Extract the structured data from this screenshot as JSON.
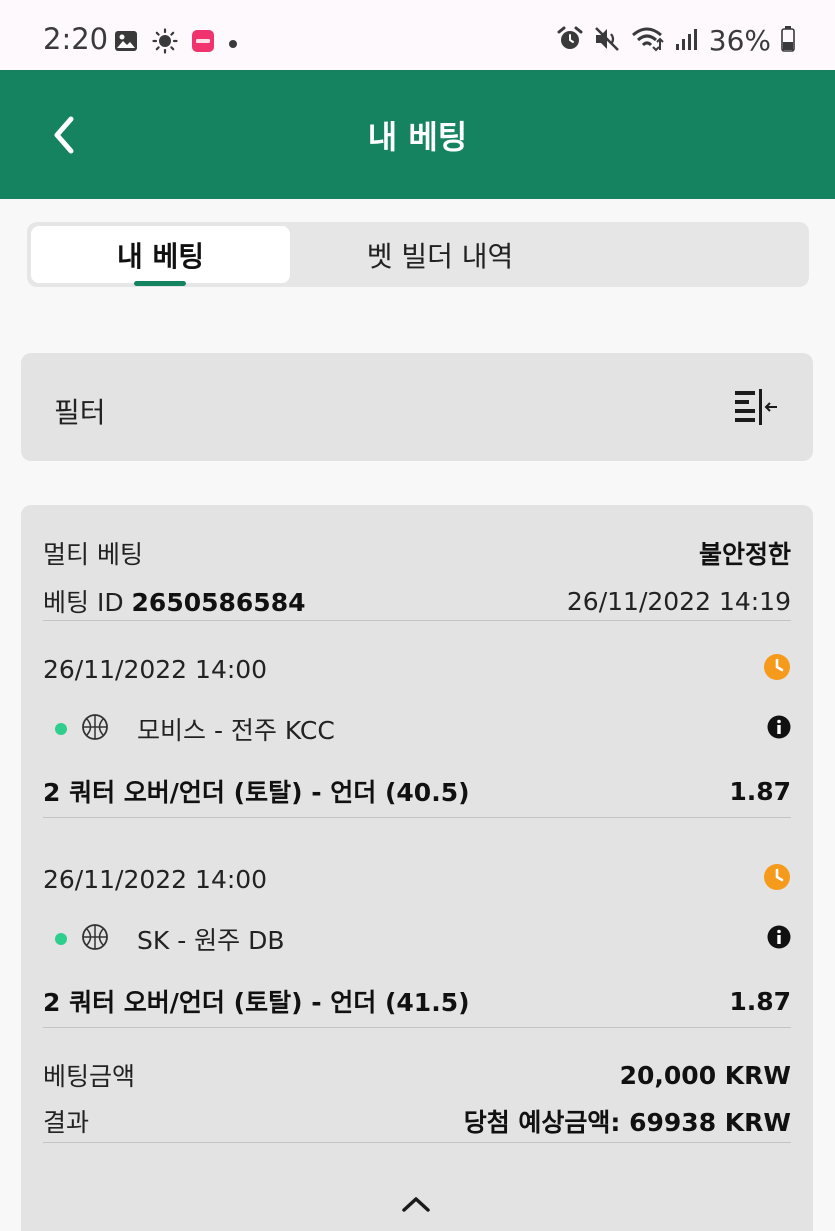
{
  "status_bar": {
    "time": "2:20",
    "battery": "36%",
    "left_icons": [
      "gallery-icon",
      "brightness-icon",
      "app-notification-icon",
      "dot-icon"
    ],
    "right_icons": [
      "alarm-icon",
      "mute-icon",
      "wifi-icon",
      "signal-icon",
      "battery-icon"
    ]
  },
  "header": {
    "title": "내 베팅",
    "accent_color": "#168360"
  },
  "tabs": [
    {
      "label": "내 베팅",
      "active": true
    },
    {
      "label": "벳 빌더 내역",
      "active": false
    }
  ],
  "filter": {
    "label": "필터"
  },
  "bet": {
    "type": "멀티 베팅",
    "status": "불안정한",
    "id_label": "베팅 ID",
    "id": "2650586584",
    "placed_at": "26/11/2022 14:19",
    "selections": [
      {
        "datetime": "26/11/2022 14:00",
        "teams": "모비스 - 전주 KCC",
        "market": "2 쿼터 오버/언더 (토탈) - 언더 (40.5)",
        "odds": "1.87"
      },
      {
        "datetime": "26/11/2022 14:00",
        "teams": "SK - 원주 DB",
        "market": "2 쿼터 오버/언더 (토탈) - 언더 (41.5)",
        "odds": "1.87"
      }
    ],
    "stake_label": "베팅금액",
    "stake": "20,000 KRW",
    "result_label": "결과",
    "result": "당첨 예상금액: 69938 KRW"
  },
  "colors": {
    "pending_clock": "#f59a1b",
    "live_dot": "#2fce8c"
  }
}
